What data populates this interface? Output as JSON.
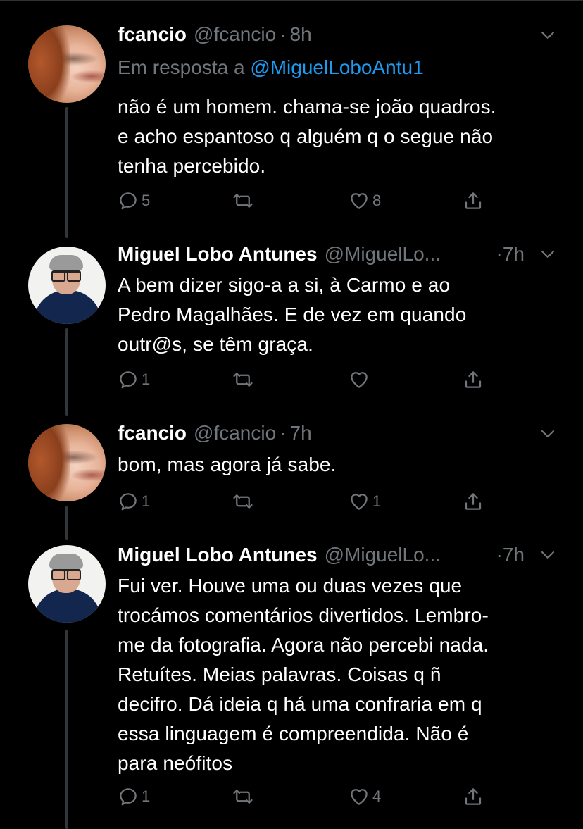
{
  "tweets": [
    {
      "name": "fcancio",
      "handle": "@fcancio",
      "time": "8h",
      "reply_prefix": "Em resposta a",
      "reply_handle": "@MiguelLoboAntu1",
      "text_lines": [
        "não é um homem. chama-se joão quadros.",
        "e acho espantoso q alguém q o segue não",
        "tenha percebido."
      ],
      "replies": "5",
      "retweets": "",
      "likes": "8"
    },
    {
      "name": "Miguel Lobo Antunes",
      "handle": "@MiguelLo...",
      "time": "7h",
      "text_lines": [
        "A bem dizer sigo-a a si, à Carmo e ao",
        "Pedro Magalhães. E de vez em quando",
        "outr@s, se têm graça."
      ],
      "replies": "1",
      "retweets": "",
      "likes": ""
    },
    {
      "name": "fcancio",
      "handle": "@fcancio",
      "time": "7h",
      "text_lines": [
        "bom, mas agora já sabe."
      ],
      "replies": "1",
      "retweets": "",
      "likes": "1"
    },
    {
      "name": "Miguel Lobo Antunes",
      "handle": "@MiguelLo...",
      "time": "7h",
      "text_lines": [
        "Fui ver. Houve uma ou duas vezes que",
        "trocámos comentários divertidos. Lembro-",
        "me da fotografia. Agora não percebi nada.",
        "Retuítes. Meias palavras. Coisas q ñ",
        "decifro. Dá ideia q há uma confraria em q",
        "essa linguagem é compreendida. Não é",
        "para neófitos"
      ],
      "replies": "1",
      "retweets": "",
      "likes": "4"
    }
  ],
  "dot_separator": "·",
  "colors": {
    "background": "#000000",
    "muted": "#71767b",
    "link": "#1d9bf0",
    "thread_line": "#333639"
  },
  "icons": [
    "reply-icon",
    "retweet-icon",
    "like-icon",
    "share-icon",
    "caret-down-icon"
  ]
}
